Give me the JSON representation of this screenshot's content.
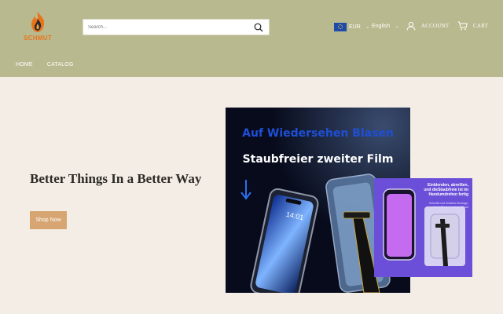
{
  "brand": {
    "logo_text": "SCHMUT"
  },
  "search": {
    "placeholder": "Search..."
  },
  "header": {
    "currency": "EUR",
    "language": "English",
    "account_label": "ACCOUNT",
    "cart_label": "CART"
  },
  "nav": {
    "items": [
      "HOME",
      "CATALOG"
    ]
  },
  "hero": {
    "title": "Better Things In a Better Way",
    "cta_label": "Shop Now"
  },
  "product_image": {
    "line1": "Auf Wiedersehen Blasen",
    "line2": "Staubfreier zweiter Film",
    "inset_text": "Einblenden, abreißen, und dieStaubfreie ist im Handumdrehen fertig",
    "inset_subtext": "Schnelle und einfache Montage, keine Blasen und kein Staub"
  },
  "colors": {
    "header_bg": "#b9b98f",
    "page_bg": "#f4ede5",
    "cta_bg": "#d6a571",
    "logo_accent": "#e8741c"
  },
  "icons": [
    "flame-logo-icon",
    "search-icon",
    "eu-flag-icon",
    "chevron-down-icon",
    "user-icon",
    "cart-icon"
  ]
}
